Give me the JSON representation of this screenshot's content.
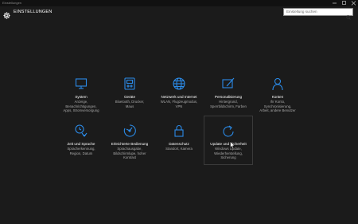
{
  "window": {
    "title": "Einstellungen"
  },
  "header": {
    "title": "EINSTELLUNGEN",
    "icon": "gear-icon"
  },
  "search": {
    "placeholder": "Einstellung suchen",
    "icon": "search-icon"
  },
  "colors": {
    "accent": "#2b8be8",
    "background": "#1b1b1b",
    "description": "#a9a9a9"
  },
  "tiles": [
    {
      "name": "System",
      "icon": "monitor-icon",
      "desc": [
        "Anzeige,",
        "Benachrichtigungen,",
        "Apps, Stromversorgung"
      ]
    },
    {
      "name": "Geräte",
      "icon": "devices-icon",
      "desc": [
        "Bluetooth, Drucker,",
        "Maus"
      ]
    },
    {
      "name": "Netzwerk und Internet",
      "icon": "globe-icon",
      "desc": [
        "WLAN, Flugzeugmodus,",
        "VPN"
      ]
    },
    {
      "name": "Personalisierung",
      "icon": "personalization-icon",
      "desc": [
        "Hintergrund,",
        "Sperrbildschirm, Farben"
      ]
    },
    {
      "name": "Konten",
      "icon": "person-icon",
      "desc": [
        "Ihr Konto,",
        "Synchronisierung,",
        "Arbeit, andere Benutzer"
      ]
    },
    {
      "name": "Zeit und Sprache",
      "icon": "time-language-icon",
      "desc": [
        "Spracherkennung,",
        "Region, Datum"
      ]
    },
    {
      "name": "Erleichterte Bedienung",
      "icon": "ease-of-access-icon",
      "desc": [
        "Sprachausgabe,",
        "Bildschirmlupe, hoher",
        "Kontrast"
      ]
    },
    {
      "name": "Datenschutz",
      "icon": "lock-icon",
      "desc": [
        "Standort, Kamera"
      ]
    },
    {
      "name": "Update und Sicherheit",
      "icon": "update-icon",
      "desc": [
        "Windows Update,",
        "Wiederherstellung,",
        "Sicherung"
      ]
    }
  ]
}
